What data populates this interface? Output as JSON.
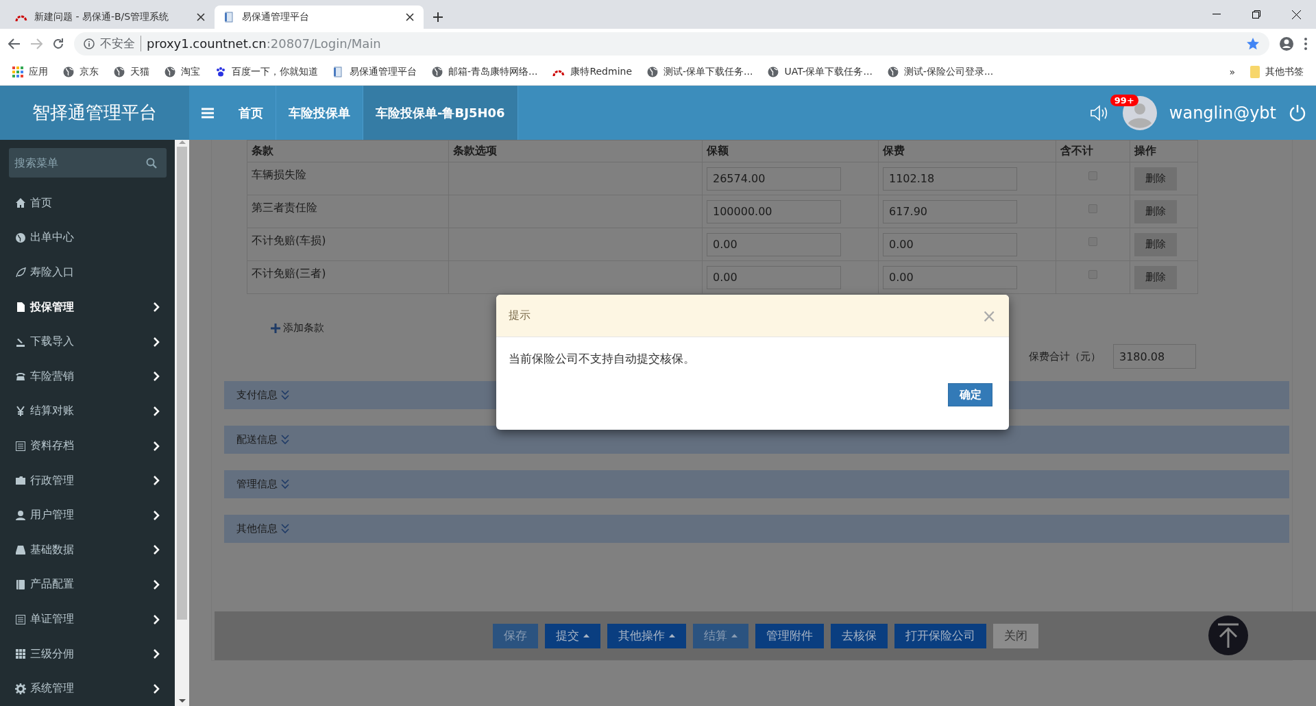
{
  "browser": {
    "tabs": [
      {
        "title": "新建问题 - 易保通-B/S管理系统",
        "selected": false
      },
      {
        "title": "易保通管理平台",
        "selected": true
      }
    ],
    "security": "不安全",
    "url_host": "proxy1.countnet.cn",
    "url_path": ":20807/Login/Main",
    "bookmarks": [
      {
        "label": "应用",
        "kind": "apps"
      },
      {
        "label": "京东",
        "kind": "globe"
      },
      {
        "label": "天猫",
        "kind": "globe"
      },
      {
        "label": "淘宝",
        "kind": "globe"
      },
      {
        "label": "百度一下，你就知道",
        "kind": "paw"
      },
      {
        "label": "易保通管理平台",
        "kind": "doc"
      },
      {
        "label": "邮箱-青岛康特网络...",
        "kind": "globe"
      },
      {
        "label": "康特Redmine",
        "kind": "arc"
      },
      {
        "label": "测试-保单下载任务...",
        "kind": "globe"
      },
      {
        "label": "UAT-保单下载任务...",
        "kind": "globe"
      },
      {
        "label": "测试-保险公司登录...",
        "kind": "globe"
      }
    ],
    "more": "»",
    "other_bookmarks": "其他书签"
  },
  "header": {
    "brand": "智择通管理平台",
    "nav": [
      {
        "label": "首页",
        "selected": false
      },
      {
        "label": "车险投保单",
        "selected": false
      },
      {
        "label": "车险投保单-鲁BJ5H06",
        "selected": true
      }
    ],
    "badge": "99+",
    "user": "wanglin@ybt"
  },
  "sidebar": {
    "search_placeholder": "搜索菜单",
    "items": [
      {
        "label": "首页",
        "kind": "home",
        "selected": false,
        "expandable": false
      },
      {
        "label": "出单中心",
        "kind": "globe",
        "selected": false,
        "expandable": false
      },
      {
        "label": "寿险入口",
        "kind": "leaf",
        "selected": false,
        "expandable": false
      },
      {
        "label": "投保管理",
        "kind": "file",
        "selected": true,
        "expandable": true
      },
      {
        "label": "下载导入",
        "kind": "download",
        "selected": false,
        "expandable": true
      },
      {
        "label": "车险营销",
        "kind": "phone",
        "selected": false,
        "expandable": true
      },
      {
        "label": "结算对账",
        "kind": "yen",
        "selected": false,
        "expandable": true
      },
      {
        "label": "资料存档",
        "kind": "list",
        "selected": false,
        "expandable": true
      },
      {
        "label": "行政管理",
        "kind": "folder",
        "selected": false,
        "expandable": true
      },
      {
        "label": "用户管理",
        "kind": "user",
        "selected": false,
        "expandable": true
      },
      {
        "label": "基础数据",
        "kind": "drive",
        "selected": false,
        "expandable": true
      },
      {
        "label": "产品配置",
        "kind": "book",
        "selected": false,
        "expandable": true
      },
      {
        "label": "单证管理",
        "kind": "list",
        "selected": false,
        "expandable": true
      },
      {
        "label": "三级分佣",
        "kind": "grid",
        "selected": false,
        "expandable": true
      },
      {
        "label": "系统管理",
        "kind": "gear",
        "selected": false,
        "expandable": true
      }
    ]
  },
  "table": {
    "columns": [
      "条款",
      "条款选项",
      "保额",
      "保费",
      "含不计",
      "操作"
    ],
    "rows": [
      {
        "clause": "车辆损失险",
        "amount": "26574.00",
        "premium": "1102.18",
        "checked": false,
        "action": "删除"
      },
      {
        "clause": "第三者责任险",
        "amount": "100000.00",
        "premium": "617.90",
        "checked": false,
        "action": "删除"
      },
      {
        "clause": "不计免赔(车损)",
        "amount": "0.00",
        "premium": "0.00",
        "checked": false,
        "action": "删除"
      },
      {
        "clause": "不计免赔(三者)",
        "amount": "0.00",
        "premium": "0.00",
        "checked": false,
        "action": "删除"
      }
    ]
  },
  "add_clause": "添加条款",
  "total": {
    "label": "保费合计（元）",
    "value": "3180.08"
  },
  "sections": [
    "支付信息",
    "配送信息",
    "管理信息",
    "其他信息"
  ],
  "actions": [
    {
      "label": "保存",
      "kind": "primary",
      "disabled": true,
      "dropdown": false
    },
    {
      "label": "提交",
      "kind": "primary",
      "disabled": false,
      "dropdown": true
    },
    {
      "label": "其他操作",
      "kind": "primary",
      "disabled": false,
      "dropdown": true
    },
    {
      "label": "结算",
      "kind": "primary",
      "disabled": true,
      "dropdown": true
    },
    {
      "label": "管理附件",
      "kind": "primary",
      "disabled": false,
      "dropdown": false
    },
    {
      "label": "去核保",
      "kind": "primary",
      "disabled": false,
      "dropdown": false
    },
    {
      "label": "打开保险公司",
      "kind": "primary",
      "disabled": false,
      "dropdown": false
    },
    {
      "label": "关闭",
      "kind": "default",
      "disabled": false,
      "dropdown": false
    }
  ],
  "dialog": {
    "title": "提示",
    "close": "×",
    "message": "当前保险公司不支持自动提交核保。",
    "ok": "确定"
  }
}
